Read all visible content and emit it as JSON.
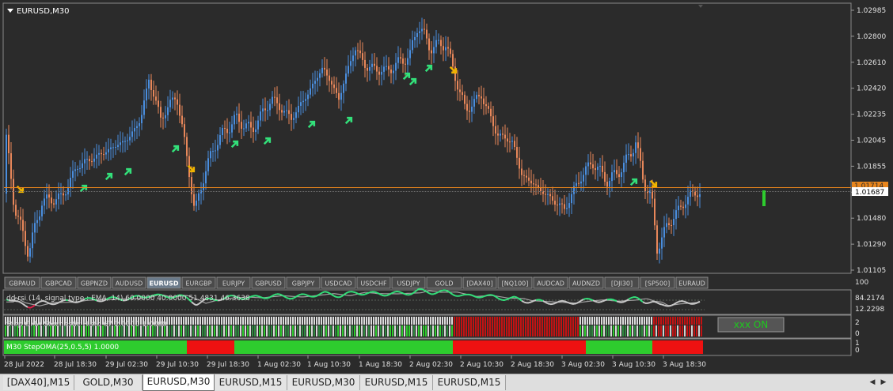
{
  "window": {
    "title": "EURUSD,M30"
  },
  "price_axis": {
    "labels": [
      "1.02985",
      "1.02800",
      "1.02610",
      "1.02420",
      "1.02235",
      "1.02045",
      "1.01855",
      "1.01670",
      "1.01480",
      "1.01290",
      "1.01105"
    ],
    "current_price": "1.01687",
    "hline_price": "1.01714"
  },
  "symbol_buttons": [
    "GBPAUD",
    "GBPCAD",
    "GBPNZD",
    "AUDUSD",
    "EURUSD",
    "EURGBP",
    "EURJPY",
    "GBPUSD",
    "GBPJPY",
    "USDCAD",
    "USDCHF",
    "USDJPY",
    "GOLD",
    "[DAX40]",
    "[NQ100]",
    "AUDCAD",
    "AUDNZD",
    "[DJI30]",
    "[SP500]",
    "EURAUD"
  ],
  "active_symbol": "EURUSD",
  "panel_rsi": {
    "label": "dd rsi (14, signal type : EMA, 14) 60.0000 40.0000 51.4831 46.3638",
    "scale": [
      "100",
      "84.2174",
      "12.2298"
    ]
  },
  "panel_stepma": {
    "label": "Step OMA Stochastic Histo 67 2.0000 1.0000",
    "scale": [
      "2",
      "0"
    ],
    "button": "xxx ON"
  },
  "panel_m30": {
    "label": "M30 StepOMA(25,0.5,5) 1.0000",
    "scale": [
      "1",
      "0"
    ]
  },
  "time_axis": [
    "28 Jul 2022",
    "28 Jul 18:30",
    "29 Jul 02:30",
    "29 Jul 10:30",
    "29 Jul 18:30",
    "1 Aug 02:30",
    "1 Aug 10:30",
    "1 Aug 18:30",
    "2 Aug 02:30",
    "2 Aug 10:30",
    "2 Aug 18:30",
    "3 Aug 02:30",
    "3 Aug 10:30",
    "3 Aug 18:30"
  ],
  "tabs": [
    "[DAX40],M15",
    "GOLD,M30",
    "EURUSD,M30",
    "EURUSD,M15",
    "EURUSD,M30",
    "EURUSD,M15",
    "EURUSD,M15"
  ],
  "active_tab_index": 2,
  "colors": {
    "background": "#2b2b2b",
    "bull_candle": "#4a8ede",
    "bear_candle": "#e8875a",
    "up_arrow": "#33e07a",
    "down_arrow": "#f0b400",
    "hline": "#e8851c",
    "green_bar": "#2ecc2e",
    "red_bar": "#ee1111",
    "on_button_text": "#1ec81e"
  }
}
